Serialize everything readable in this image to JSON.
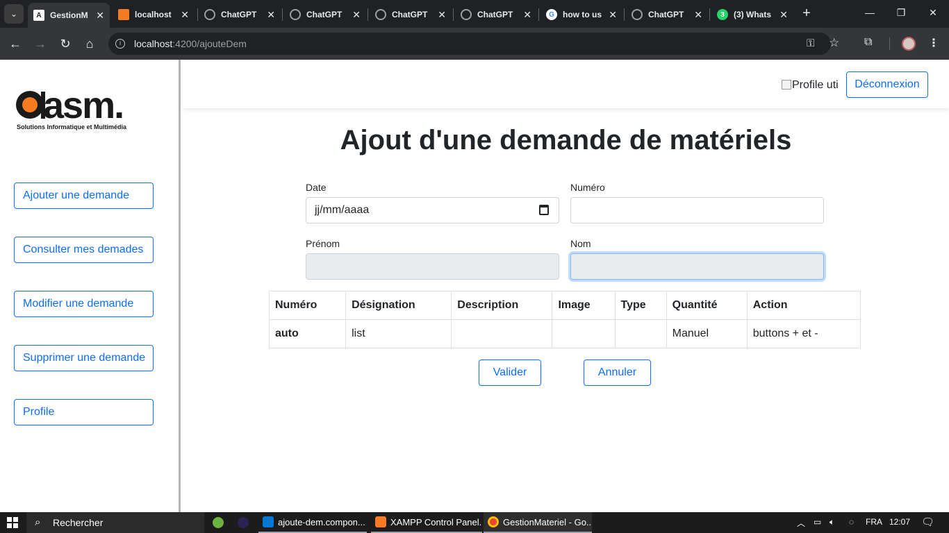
{
  "browser": {
    "tabs": [
      {
        "title": "GestionM",
        "favicon": "angular-icon",
        "active": true
      },
      {
        "title": "localhost",
        "favicon": "xampp-icon"
      },
      {
        "title": "ChatGPT",
        "favicon": "chatgpt-icon"
      },
      {
        "title": "ChatGPT",
        "favicon": "chatgpt-icon"
      },
      {
        "title": "ChatGPT",
        "favicon": "chatgpt-icon"
      },
      {
        "title": "ChatGPT",
        "favicon": "chatgpt-icon"
      },
      {
        "title": "how to us",
        "favicon": "google-icon"
      },
      {
        "title": "ChatGPT",
        "favicon": "chatgpt-icon"
      },
      {
        "title": "(3) Whats",
        "favicon": "whatsapp-icon",
        "badge": "3"
      }
    ],
    "url_host": "localhost",
    "url_rest": ":4200/ajouteDem"
  },
  "sidebar": {
    "logo_text": "asm.",
    "logo_tagline": "Solutions Informatique et Multimédia",
    "items": [
      {
        "label": "Ajouter une demande"
      },
      {
        "label": "Consulter mes demades"
      },
      {
        "label": "Modifier une demande"
      },
      {
        "label": "Supprimer une demande"
      },
      {
        "label": "Profile"
      }
    ]
  },
  "header": {
    "profile_alt": "Profile uti",
    "logout_label": "Déconnexion"
  },
  "main": {
    "title": "Ajout d'une demande de matériels",
    "form": {
      "date_label": "Date",
      "date_placeholder": "jj/mm/aaaa",
      "numero_label": "Numéro",
      "numero_value": "",
      "prenom_label": "Prénom",
      "prenom_value": "",
      "nom_label": "Nom",
      "nom_value": ""
    },
    "table": {
      "headers": [
        "Numéro",
        "Désignation",
        "Description",
        "Image",
        "Type",
        "Quantité",
        "Action"
      ],
      "rows": [
        [
          "auto",
          "list",
          "",
          "",
          "",
          "Manuel",
          "buttons + et -"
        ]
      ]
    },
    "validate_label": "Valider",
    "cancel_label": "Annuler"
  },
  "taskbar": {
    "search_label": "Rechercher",
    "apps": [
      {
        "title": "ajoute-dem.compon..."
      },
      {
        "title": "XAMPP Control Panel..."
      },
      {
        "title": "GestionMateriel - Go..."
      }
    ],
    "language": "FRA",
    "time": "12:07"
  },
  "colors": {
    "primary": "#0d6efd",
    "tabstrip": "#202124",
    "toolbar": "#35363a",
    "asm_orange": "#f47b20"
  }
}
